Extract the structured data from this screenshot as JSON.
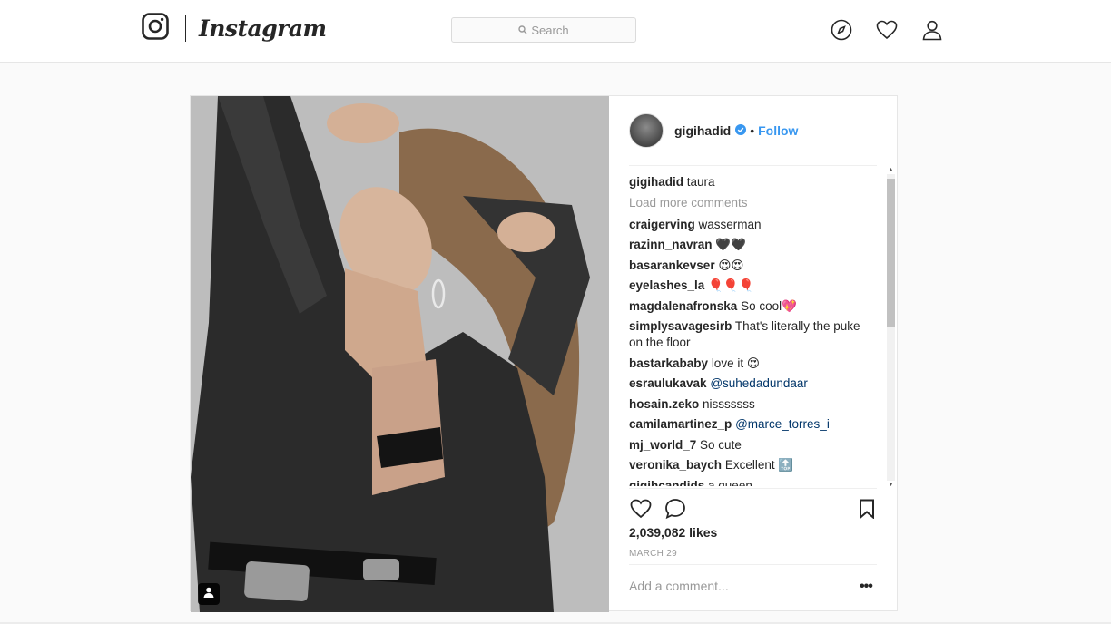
{
  "brand": {
    "name": "Instagram"
  },
  "search": {
    "placeholder": "Search"
  },
  "nav": {
    "icons": [
      "compass-icon",
      "heart-icon",
      "profile-icon"
    ]
  },
  "post": {
    "author": "gigihadid",
    "follow_label": "Follow",
    "separator": "•",
    "caption": {
      "user": "gigihadid",
      "text": "taura"
    },
    "load_more": "Load more comments",
    "comments": [
      {
        "user": "craigerving",
        "text": "wasserman"
      },
      {
        "user": "razinn_navran",
        "text": "🖤🖤"
      },
      {
        "user": "basarankevser",
        "text": "😍😍"
      },
      {
        "user": "eyelashes_la",
        "text": "🎈🎈🎈"
      },
      {
        "user": "magdalenafronska",
        "text": "So cool💖"
      },
      {
        "user": "simplysavagesirb",
        "text": "That's literally the puke on the floor"
      },
      {
        "user": "bastarkababy",
        "text": "love it 😍"
      },
      {
        "user": "esraulukavak",
        "mention": "@suhedadundaar"
      },
      {
        "user": "hosain.zeko",
        "text": "nisssssss"
      },
      {
        "user": "camilamartinez_p",
        "mention": "@marce_torres_i"
      },
      {
        "user": "mj_world_7",
        "text": "So cute"
      },
      {
        "user": "veronika_baych",
        "text": "Excellent 🔝"
      },
      {
        "user": "gigihcandids",
        "text": "a queen"
      }
    ],
    "likes": "2,039,082 likes",
    "date": "MARCH 29",
    "add_comment_placeholder": "Add a comment...",
    "more_label": "•••"
  },
  "colors": {
    "accent": "#3897f0",
    "mention": "#003569",
    "muted": "#999999"
  }
}
